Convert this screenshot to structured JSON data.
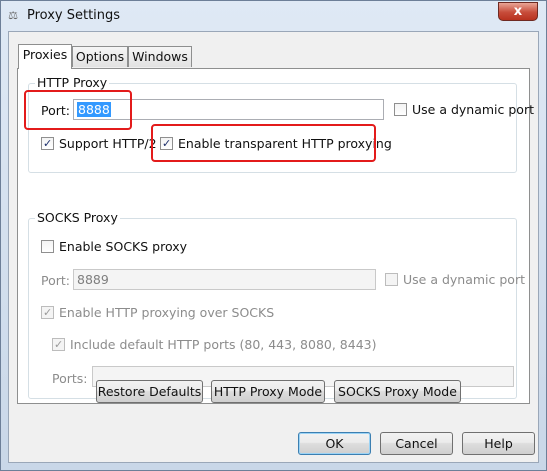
{
  "window": {
    "title": "Proxy Settings",
    "close_label": "x"
  },
  "tabs": [
    "Proxies",
    "Options",
    "Windows"
  ],
  "http_proxy": {
    "group_label": "HTTP Proxy",
    "port_label": "Port:",
    "port_value": "8888",
    "dynamic_port_label": "Use a dynamic port",
    "support_http2_label": "Support HTTP/2",
    "transparent_label": "Enable transparent HTTP proxying"
  },
  "socks_proxy": {
    "group_label": "SOCKS Proxy",
    "enable_label": "Enable SOCKS proxy",
    "port_label": "Port:",
    "port_value": "8889",
    "dynamic_port_label": "Use a dynamic port",
    "http_over_socks_label": "Enable HTTP proxying over SOCKS",
    "include_ports_label": "Include default HTTP ports (80, 443, 8080, 8443)",
    "ports_label": "Ports:",
    "ports_value": ""
  },
  "buttons": {
    "restore": "Restore Defaults",
    "http_mode": "HTTP Proxy Mode",
    "socks_mode": "SOCKS Proxy Mode",
    "ok": "OK",
    "cancel": "Cancel",
    "help": "Help"
  },
  "colors": {
    "highlight": "#e31b1b",
    "selection": "#3399ff"
  }
}
